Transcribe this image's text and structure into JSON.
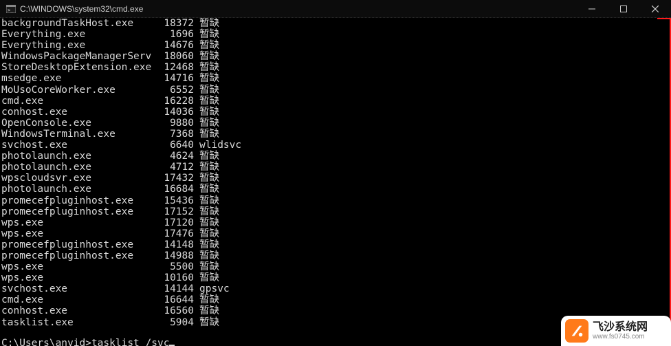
{
  "window": {
    "title": "C:\\WINDOWS\\system32\\cmd.exe"
  },
  "processes": [
    {
      "name": "backgroundTaskHost.exe",
      "pid": "18372",
      "svc": "暂缺"
    },
    {
      "name": "Everything.exe",
      "pid": "1696",
      "svc": "暂缺"
    },
    {
      "name": "Everything.exe",
      "pid": "14676",
      "svc": "暂缺"
    },
    {
      "name": "WindowsPackageManagerServ",
      "pid": "18060",
      "svc": "暂缺"
    },
    {
      "name": "StoreDesktopExtension.exe",
      "pid": "12468",
      "svc": "暂缺"
    },
    {
      "name": "msedge.exe",
      "pid": "14716",
      "svc": "暂缺"
    },
    {
      "name": "MoUsoCoreWorker.exe",
      "pid": "6552",
      "svc": "暂缺"
    },
    {
      "name": "cmd.exe",
      "pid": "16228",
      "svc": "暂缺"
    },
    {
      "name": "conhost.exe",
      "pid": "14036",
      "svc": "暂缺"
    },
    {
      "name": "OpenConsole.exe",
      "pid": "9880",
      "svc": "暂缺"
    },
    {
      "name": "WindowsTerminal.exe",
      "pid": "7368",
      "svc": "暂缺"
    },
    {
      "name": "svchost.exe",
      "pid": "6640",
      "svc": "wlidsvc"
    },
    {
      "name": "photolaunch.exe",
      "pid": "4624",
      "svc": "暂缺"
    },
    {
      "name": "photolaunch.exe",
      "pid": "4712",
      "svc": "暂缺"
    },
    {
      "name": "wpscloudsvr.exe",
      "pid": "17432",
      "svc": "暂缺"
    },
    {
      "name": "photolaunch.exe",
      "pid": "16684",
      "svc": "暂缺"
    },
    {
      "name": "promecefpluginhost.exe",
      "pid": "15436",
      "svc": "暂缺"
    },
    {
      "name": "promecefpluginhost.exe",
      "pid": "17152",
      "svc": "暂缺"
    },
    {
      "name": "wps.exe",
      "pid": "17120",
      "svc": "暂缺"
    },
    {
      "name": "wps.exe",
      "pid": "17476",
      "svc": "暂缺"
    },
    {
      "name": "promecefpluginhost.exe",
      "pid": "14148",
      "svc": "暂缺"
    },
    {
      "name": "promecefpluginhost.exe",
      "pid": "14988",
      "svc": "暂缺"
    },
    {
      "name": "wps.exe",
      "pid": "5500",
      "svc": "暂缺"
    },
    {
      "name": "wps.exe",
      "pid": "10160",
      "svc": "暂缺"
    },
    {
      "name": "svchost.exe",
      "pid": "14144",
      "svc": "gpsvc"
    },
    {
      "name": "cmd.exe",
      "pid": "16644",
      "svc": "暂缺"
    },
    {
      "name": "conhost.exe",
      "pid": "16560",
      "svc": "暂缺"
    },
    {
      "name": "tasklist.exe",
      "pid": "5904",
      "svc": "暂缺"
    }
  ],
  "prompt": {
    "path": "C:\\Users\\anyid>",
    "command": "tasklist /svc"
  },
  "watermark": {
    "title": "飞沙系统网",
    "url": "www.fs0745.com"
  }
}
